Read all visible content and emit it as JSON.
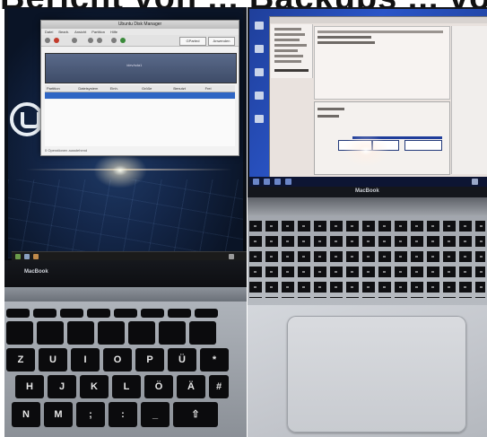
{
  "caption": {
    "text": "Bericht von ... Backups ... vom ..."
  },
  "left_photo": {
    "app_window": {
      "title": "Ubuntu Disk Manager",
      "menu": [
        "Datei",
        "Bearb.",
        "Ansicht",
        "Partition",
        "Hilfe"
      ],
      "toolbar_buttons": [
        "GParted",
        "Anwenden"
      ],
      "graph_label": "/dev/sda1",
      "table_headers": [
        "Partition",
        "Dateisystem",
        "Einh.",
        "Größe",
        "Benutzt",
        "Frei"
      ],
      "status": "0 Operationen ausstehend"
    },
    "laptop_label": "MacBook",
    "keyboard_rows": [
      [
        "Z",
        "U",
        "I",
        "O",
        "P",
        "Ü",
        "*"
      ],
      [
        "H",
        "J",
        "K",
        "L",
        "Ö",
        "Ä",
        "#"
      ],
      [
        "N",
        "M",
        ";",
        ":",
        "_",
        "⇧"
      ]
    ]
  },
  "right_photo": {
    "laptop_label": "MacBook"
  }
}
